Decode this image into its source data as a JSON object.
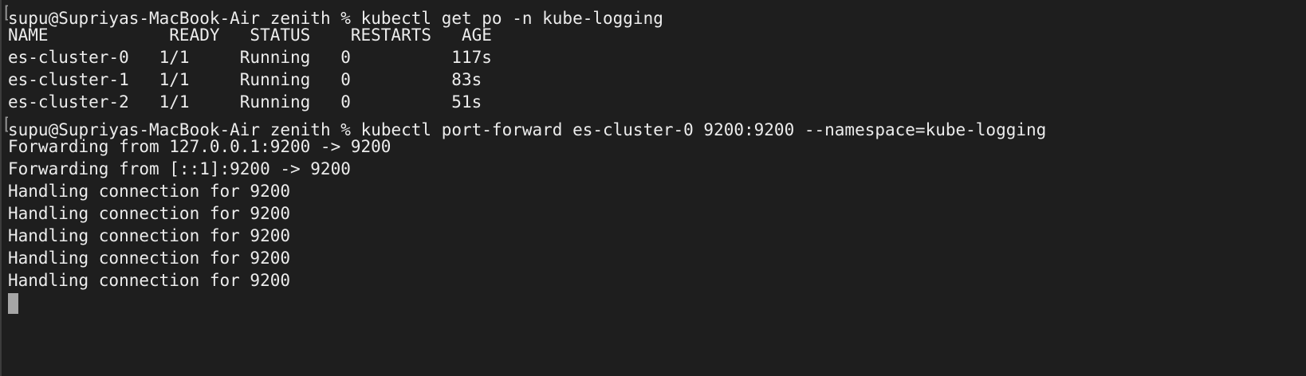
{
  "prompt": {
    "user_host": "supu@Supriyas-MacBook-Air",
    "dir": "zenith",
    "symbol": "%"
  },
  "commands": {
    "get_pods": "kubectl get po -n kube-logging",
    "port_forward": "kubectl port-forward es-cluster-0 9200:9200 --namespace=kube-logging"
  },
  "pod_table": {
    "header": "NAME            READY   STATUS    RESTARTS   AGE",
    "rows": [
      "es-cluster-0   1/1     Running   0          117s",
      "es-cluster-1   1/1     Running   0          83s",
      "es-cluster-2   1/1     Running   0          51s"
    ]
  },
  "forwarding": [
    "Forwarding from 127.0.0.1:9200 -> 9200",
    "Forwarding from [::1]:9200 -> 9200"
  ],
  "connections": [
    "Handling connection for 9200",
    "Handling connection for 9200",
    "Handling connection for 9200",
    "Handling connection for 9200",
    "Handling connection for 9200"
  ],
  "bracket_char": "[",
  "colors": {
    "background": "#1e1e1e",
    "text": "#ececec",
    "cursor": "#a6a6a6"
  }
}
